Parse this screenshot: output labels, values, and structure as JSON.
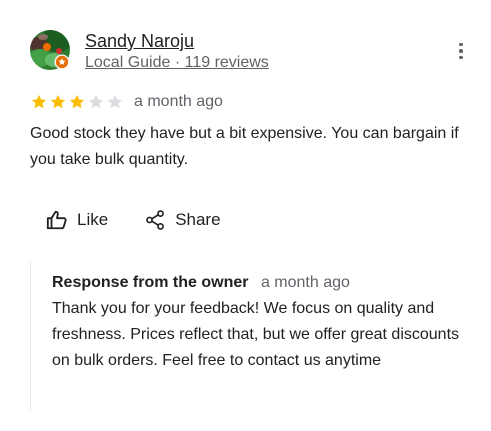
{
  "review": {
    "author": {
      "name": "Sandy Naroju",
      "meta": "Local Guide · 119 reviews",
      "avatar_icon": "avatar-local-guide-icon"
    },
    "rating": {
      "stars": 3,
      "max_stars": 5,
      "filled_color": "#fbbc04",
      "empty_color": "#dadce0"
    },
    "time": "a month ago",
    "text": "Good stock they have but a bit expensive. You can bargain if you take bulk quantity.",
    "actions": {
      "like_label": "Like",
      "like_icon": "thumbs-up-icon",
      "share_label": "Share",
      "share_icon": "share-icon"
    },
    "more_icon": "more-vert-icon"
  },
  "owner_response": {
    "label": "Response from the owner",
    "time": "a month ago",
    "text": "Thank you for your feedback! We focus on quality and freshness. Prices reflect that, but we offer great discounts on bulk orders. Feel free to contact us anytime"
  }
}
